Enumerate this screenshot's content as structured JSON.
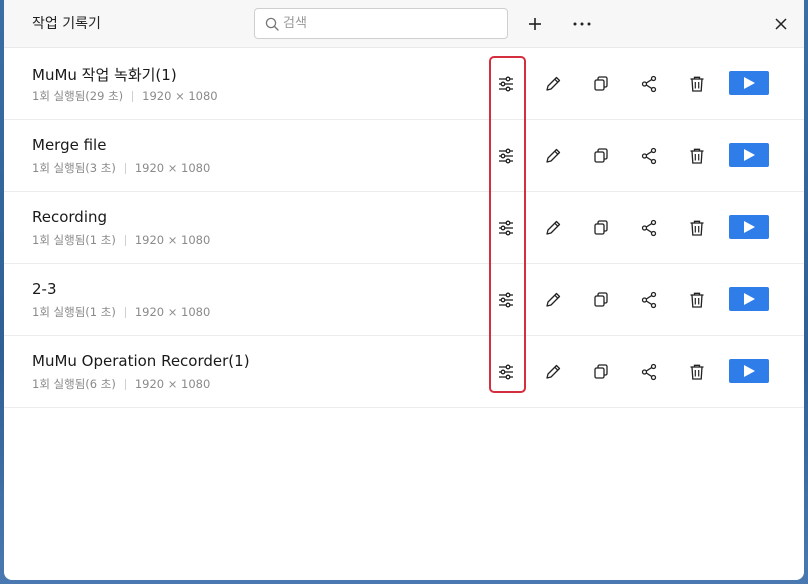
{
  "window": {
    "title": "작업 기록기"
  },
  "search": {
    "placeholder": "검색",
    "value": ""
  },
  "toolbar": {
    "add_icon": "plus-icon",
    "more_icon": "more-horizontal-icon",
    "close_icon": "close-icon"
  },
  "colors": {
    "play_button": "#2f7de8",
    "highlight_border": "#d32f3f"
  },
  "records": [
    {
      "name": "MuMu 작업 녹화기(1)",
      "runs": "1회 실행됨(29 초)",
      "resolution": "1920 × 1080"
    },
    {
      "name": "Merge file",
      "runs": "1회 실행됨(3 초)",
      "resolution": "1920 × 1080"
    },
    {
      "name": "Recording",
      "runs": "1회 실행됨(1 초)",
      "resolution": "1920 × 1080"
    },
    {
      "name": "2-3",
      "runs": "1회 실행됨(1 초)",
      "resolution": "1920 × 1080"
    },
    {
      "name": "MuMu Operation Recorder(1)",
      "runs": "1회 실행됨(6 초)",
      "resolution": "1920 × 1080"
    }
  ],
  "row_actions": [
    "settings-sliders-icon",
    "edit-pencil-icon",
    "copy-icon",
    "share-icon",
    "delete-trash-icon",
    "play-icon"
  ]
}
